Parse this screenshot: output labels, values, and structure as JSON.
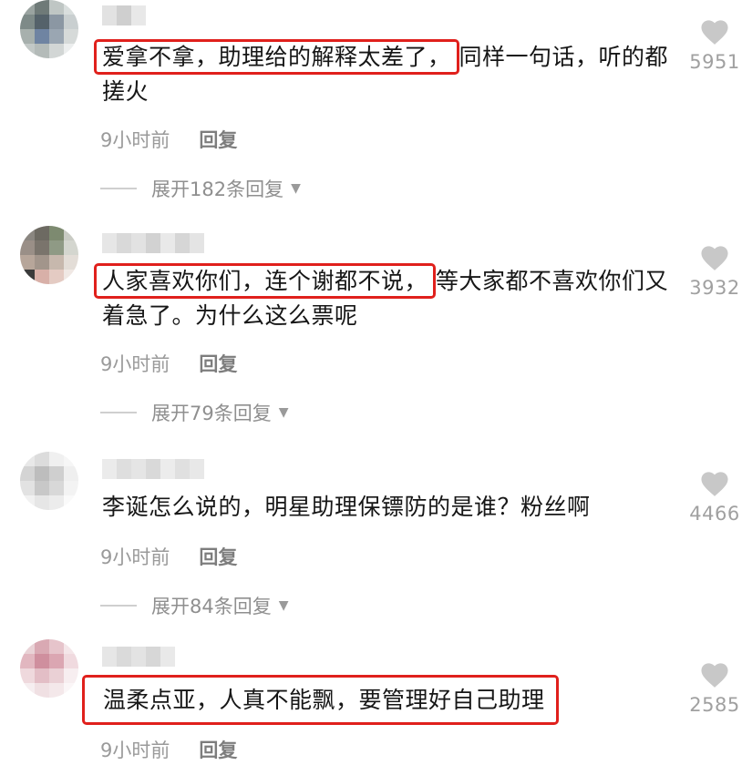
{
  "comments": [
    {
      "highlight": "爱拿不拿，助理给的解释太差了，",
      "rest": "同样一句话，听的都搓火",
      "time": "9小时前",
      "reply_label": "回复",
      "expand_label": "展开182条回复",
      "likes": "5951"
    },
    {
      "highlight": "人家喜欢你们，连个谢都不说，",
      "rest": "等大家都不喜欢你们又着急了。为什么这么票呢",
      "time": "9小时前",
      "reply_label": "回复",
      "expand_label": "展开79条回复",
      "likes": "3932"
    },
    {
      "highlight": "",
      "rest": "李诞怎么说的，明星助理保镖防的是谁？粉丝啊",
      "time": "9小时前",
      "reply_label": "回复",
      "expand_label": "展开84条回复",
      "likes": "4466"
    },
    {
      "highlight": "温柔点亚，人真不能飘，要管理好自己助理",
      "rest": "",
      "time": "9小时前",
      "reply_label": "回复",
      "expand_label": "",
      "likes": "2585"
    }
  ],
  "colors": {
    "highlight_border": "#e0201c",
    "meta_text": "#9a9a9a",
    "like_icon": "#c8c8c8"
  },
  "icons": {
    "like": "heart-icon",
    "expand": "caret-down-icon"
  }
}
